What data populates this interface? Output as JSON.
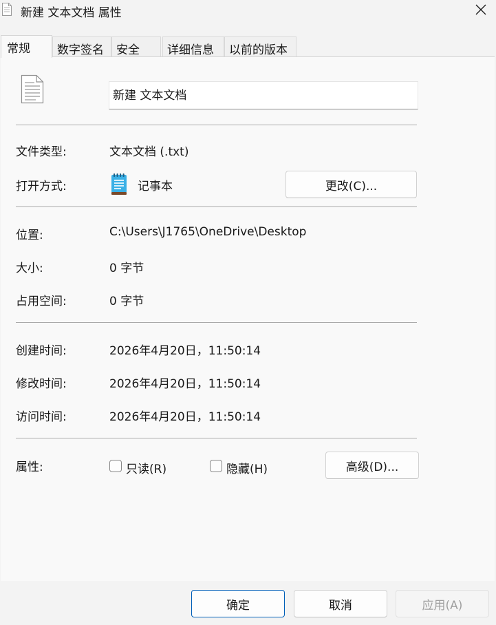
{
  "window": {
    "title": "新建 文本文档 属性"
  },
  "tabs": [
    {
      "label": "常规",
      "active": true
    },
    {
      "label": "数字签名"
    },
    {
      "label": "安全"
    },
    {
      "label": "详细信息"
    },
    {
      "label": "以前的版本"
    }
  ],
  "file": {
    "name": "新建 文本文档"
  },
  "info": {
    "type_label": "文件类型:",
    "type_value": "文本文档 (.txt)",
    "open_label": "打开方式:",
    "open_app": "记事本",
    "change_button": "更改(C)...",
    "location_label": "位置:",
    "location_value": "C:\\Users\\J1765\\OneDrive\\Desktop",
    "size_label": "大小:",
    "size_value": "0 字节",
    "disk_label": "占用空间:",
    "disk_value": "0 字节",
    "created_label": "创建时间:",
    "created_value": "2026年4月20日，11:50:14",
    "modified_label": "修改时间:",
    "modified_value": "2026年4月20日，11:50:14",
    "accessed_label": "访问时间:",
    "accessed_value": "2026年4月20日，11:50:14"
  },
  "attributes": {
    "label": "属性:",
    "readonly_label": "只读(R)",
    "readonly_checked": false,
    "hidden_label": "隐藏(H)",
    "hidden_checked": false,
    "advanced_button": "高级(D)..."
  },
  "footer": {
    "ok": "确定",
    "cancel": "取消",
    "apply": "应用(A)"
  },
  "icons": {
    "file": "text-document-icon",
    "app": "notepad-icon",
    "close": "close-icon"
  },
  "colors": {
    "primary_border": "#005fb8",
    "background": "#f3f3f3",
    "panel": "#f9f9f9"
  }
}
